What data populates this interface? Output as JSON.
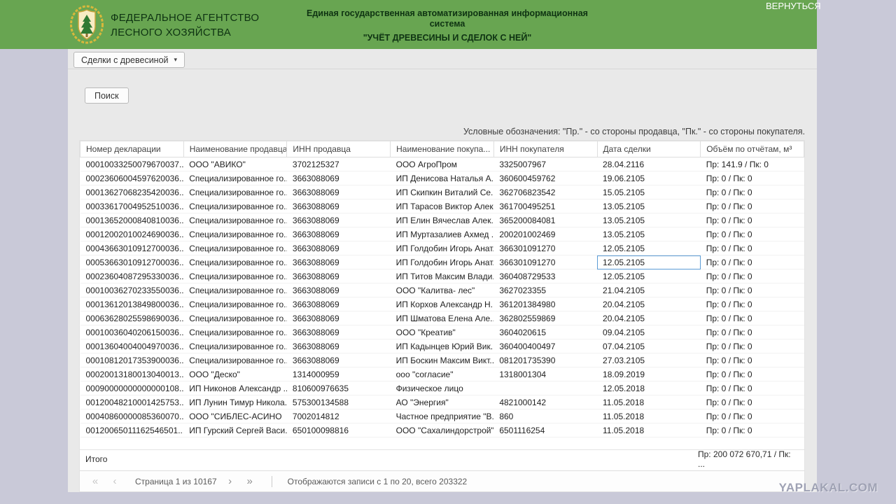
{
  "header": {
    "agency_name_line1": "ФЕДЕРАЛЬНОЕ АГЕНТСТВО",
    "agency_name_line2": "ЛЕСНОГО ХОЗЯЙСТВА",
    "system_name_line1": "Единая государственная автоматизированная информационная система",
    "system_name_line2": "\"УЧЁТ ДРЕВЕСИНЫ И СДЕЛОК С НЕЙ\"",
    "return_link": "ВЕРНУТЬСЯ",
    "logo_icon": "coat-of-arms-icon"
  },
  "toolbar": {
    "deals_menu_label": "Сделки с древесиной",
    "menu_caret_icon": "▾",
    "search_button_label": "Поиск"
  },
  "legend_text": "Условные обозначения: \"Пр.\" - со стороны продавца, \"Пк.\" - со стороны покупателя.",
  "table": {
    "columns": [
      "Номер декларации",
      "Наименование продавца",
      "ИНН продавца",
      "Наименование покупа...",
      "ИНН покупателя",
      "Дата сделки",
      "Объём по отчётам, м³"
    ],
    "rows": [
      [
        "00010033250079670037...",
        "ООО \"АВИКО\"",
        "3702125327",
        "ООО АгроПром",
        "3325007967",
        "28.04.2116",
        "Пр: 141.9 / Пк: 0"
      ],
      [
        "00023606004597620036...",
        "Специализированное го...",
        "3663088069",
        "ИП Денисова Наталья А...",
        "360600459762",
        "19.06.2105",
        "Пр: 0 / Пк: 0"
      ],
      [
        "00013627068235420036...",
        "Специализированное го...",
        "3663088069",
        "ИП Скипкин Виталий Се...",
        "362706823542",
        "15.05.2105",
        "Пр: 0 / Пк: 0"
      ],
      [
        "00033617004952510036...",
        "Специализированное го...",
        "3663088069",
        "ИП Тарасов Виктор Алек...",
        "361700495251",
        "13.05.2105",
        "Пр: 0 / Пк: 0"
      ],
      [
        "00013652000840810036...",
        "Специализированное го...",
        "3663088069",
        "ИП Елин Вячеслав Алек...",
        "365200084081",
        "13.05.2105",
        "Пр: 0 / Пк: 0"
      ],
      [
        "00012002010024690036...",
        "Специализированное го...",
        "3663088069",
        "ИП Муртазалиев Ахмед ...",
        "200201002469",
        "13.05.2105",
        "Пр: 0 / Пк: 0"
      ],
      [
        "00043663010912700036...",
        "Специализированное го...",
        "3663088069",
        "ИП Голдобин Игорь Анат...",
        "366301091270",
        "12.05.2105",
        "Пр: 0 / Пк: 0"
      ],
      [
        "00053663010912700036...",
        "Специализированное го...",
        "3663088069",
        "ИП Голдобин Игорь Анат...",
        "366301091270",
        "12.05.2105",
        "Пр: 0 / Пк: 0"
      ],
      [
        "00023604087295330036...",
        "Специализированное го...",
        "3663088069",
        "ИП Титов Максим Влади...",
        "360408729533",
        "12.05.2105",
        "Пр: 0 / Пк: 0"
      ],
      [
        "00010036270233550036...",
        "Специализированное го...",
        "3663088069",
        "ООО \"Калитва- лес\"",
        "3627023355",
        "21.04.2105",
        "Пр: 0 / Пк: 0"
      ],
      [
        "00013612013849800036...",
        "Специализированное го...",
        "3663088069",
        "ИП Корхов Александр Н...",
        "361201384980",
        "20.04.2105",
        "Пр: 0 / Пк: 0"
      ],
      [
        "00063628025598690036...",
        "Специализированное го...",
        "3663088069",
        "ИП Шматова Елена Але...",
        "362802559869",
        "20.04.2105",
        "Пр: 0 / Пк: 0"
      ],
      [
        "00010036040206150036...",
        "Специализированное го...",
        "3663088069",
        "ООО \"Креатив\"",
        "3604020615",
        "09.04.2105",
        "Пр: 0 / Пк: 0"
      ],
      [
        "00013604004004970036...",
        "Специализированное го...",
        "3663088069",
        "ИП Кадынцев Юрий Вик...",
        "360400400497",
        "07.04.2105",
        "Пр: 0 / Пк: 0"
      ],
      [
        "00010812017353900036...",
        "Специализированное го...",
        "3663088069",
        "ИП Боскин Максим Викт...",
        "081201735390",
        "27.03.2105",
        "Пр: 0 / Пк: 0"
      ],
      [
        "00020013180013040013...",
        "ООО \"Деско\"",
        "1314000959",
        "ооо \"согласие\"",
        "1318001304",
        "18.09.2019",
        "Пр: 0 / Пк: 0"
      ],
      [
        "00090000000000000108...",
        "ИП Никонов Александр ...",
        "810600976635",
        "Физическое лицо",
        "",
        "12.05.2018",
        "Пр: 0 / Пк: 0"
      ],
      [
        "00120048210001425753...",
        "ИП Лунин Тимур Никола...",
        "575300134588",
        "АО \"Энергия\"",
        "4821000142",
        "11.05.2018",
        "Пр: 0 / Пк: 0"
      ],
      [
        "00040860000085360070...",
        "ООО \"СИБЛЕС-АСИНО",
        "7002014812",
        "Частное предприятие \"В...",
        "860",
        "11.05.2018",
        "Пр: 0 / Пк: 0"
      ],
      [
        "00120065011162546501...",
        "ИП Гурский Сергей Васи...",
        "650100098816",
        "ООО \"Сахалиндорстрой\"",
        "6501116254",
        "11.05.2018",
        "Пр: 0 / Пк: 0"
      ]
    ],
    "selected_cell": {
      "row": 7,
      "col": 5
    },
    "footer_label": "Итого",
    "footer_total": "Пр: 200 072 670,71 / Пк: ..."
  },
  "pagination": {
    "first_icon": "«",
    "prev_icon": "‹",
    "next_icon": "›",
    "last_icon": "»",
    "page_label": "Страница 1 из 10167",
    "records_label": "Отображаются записи с 1 по 20, всего 203322"
  },
  "watermark": "YAPLAKAL.COM",
  "colors": {
    "header_green": "#68a551",
    "page_background": "#c9c9d8",
    "selection_blue": "#5b9bd5"
  }
}
